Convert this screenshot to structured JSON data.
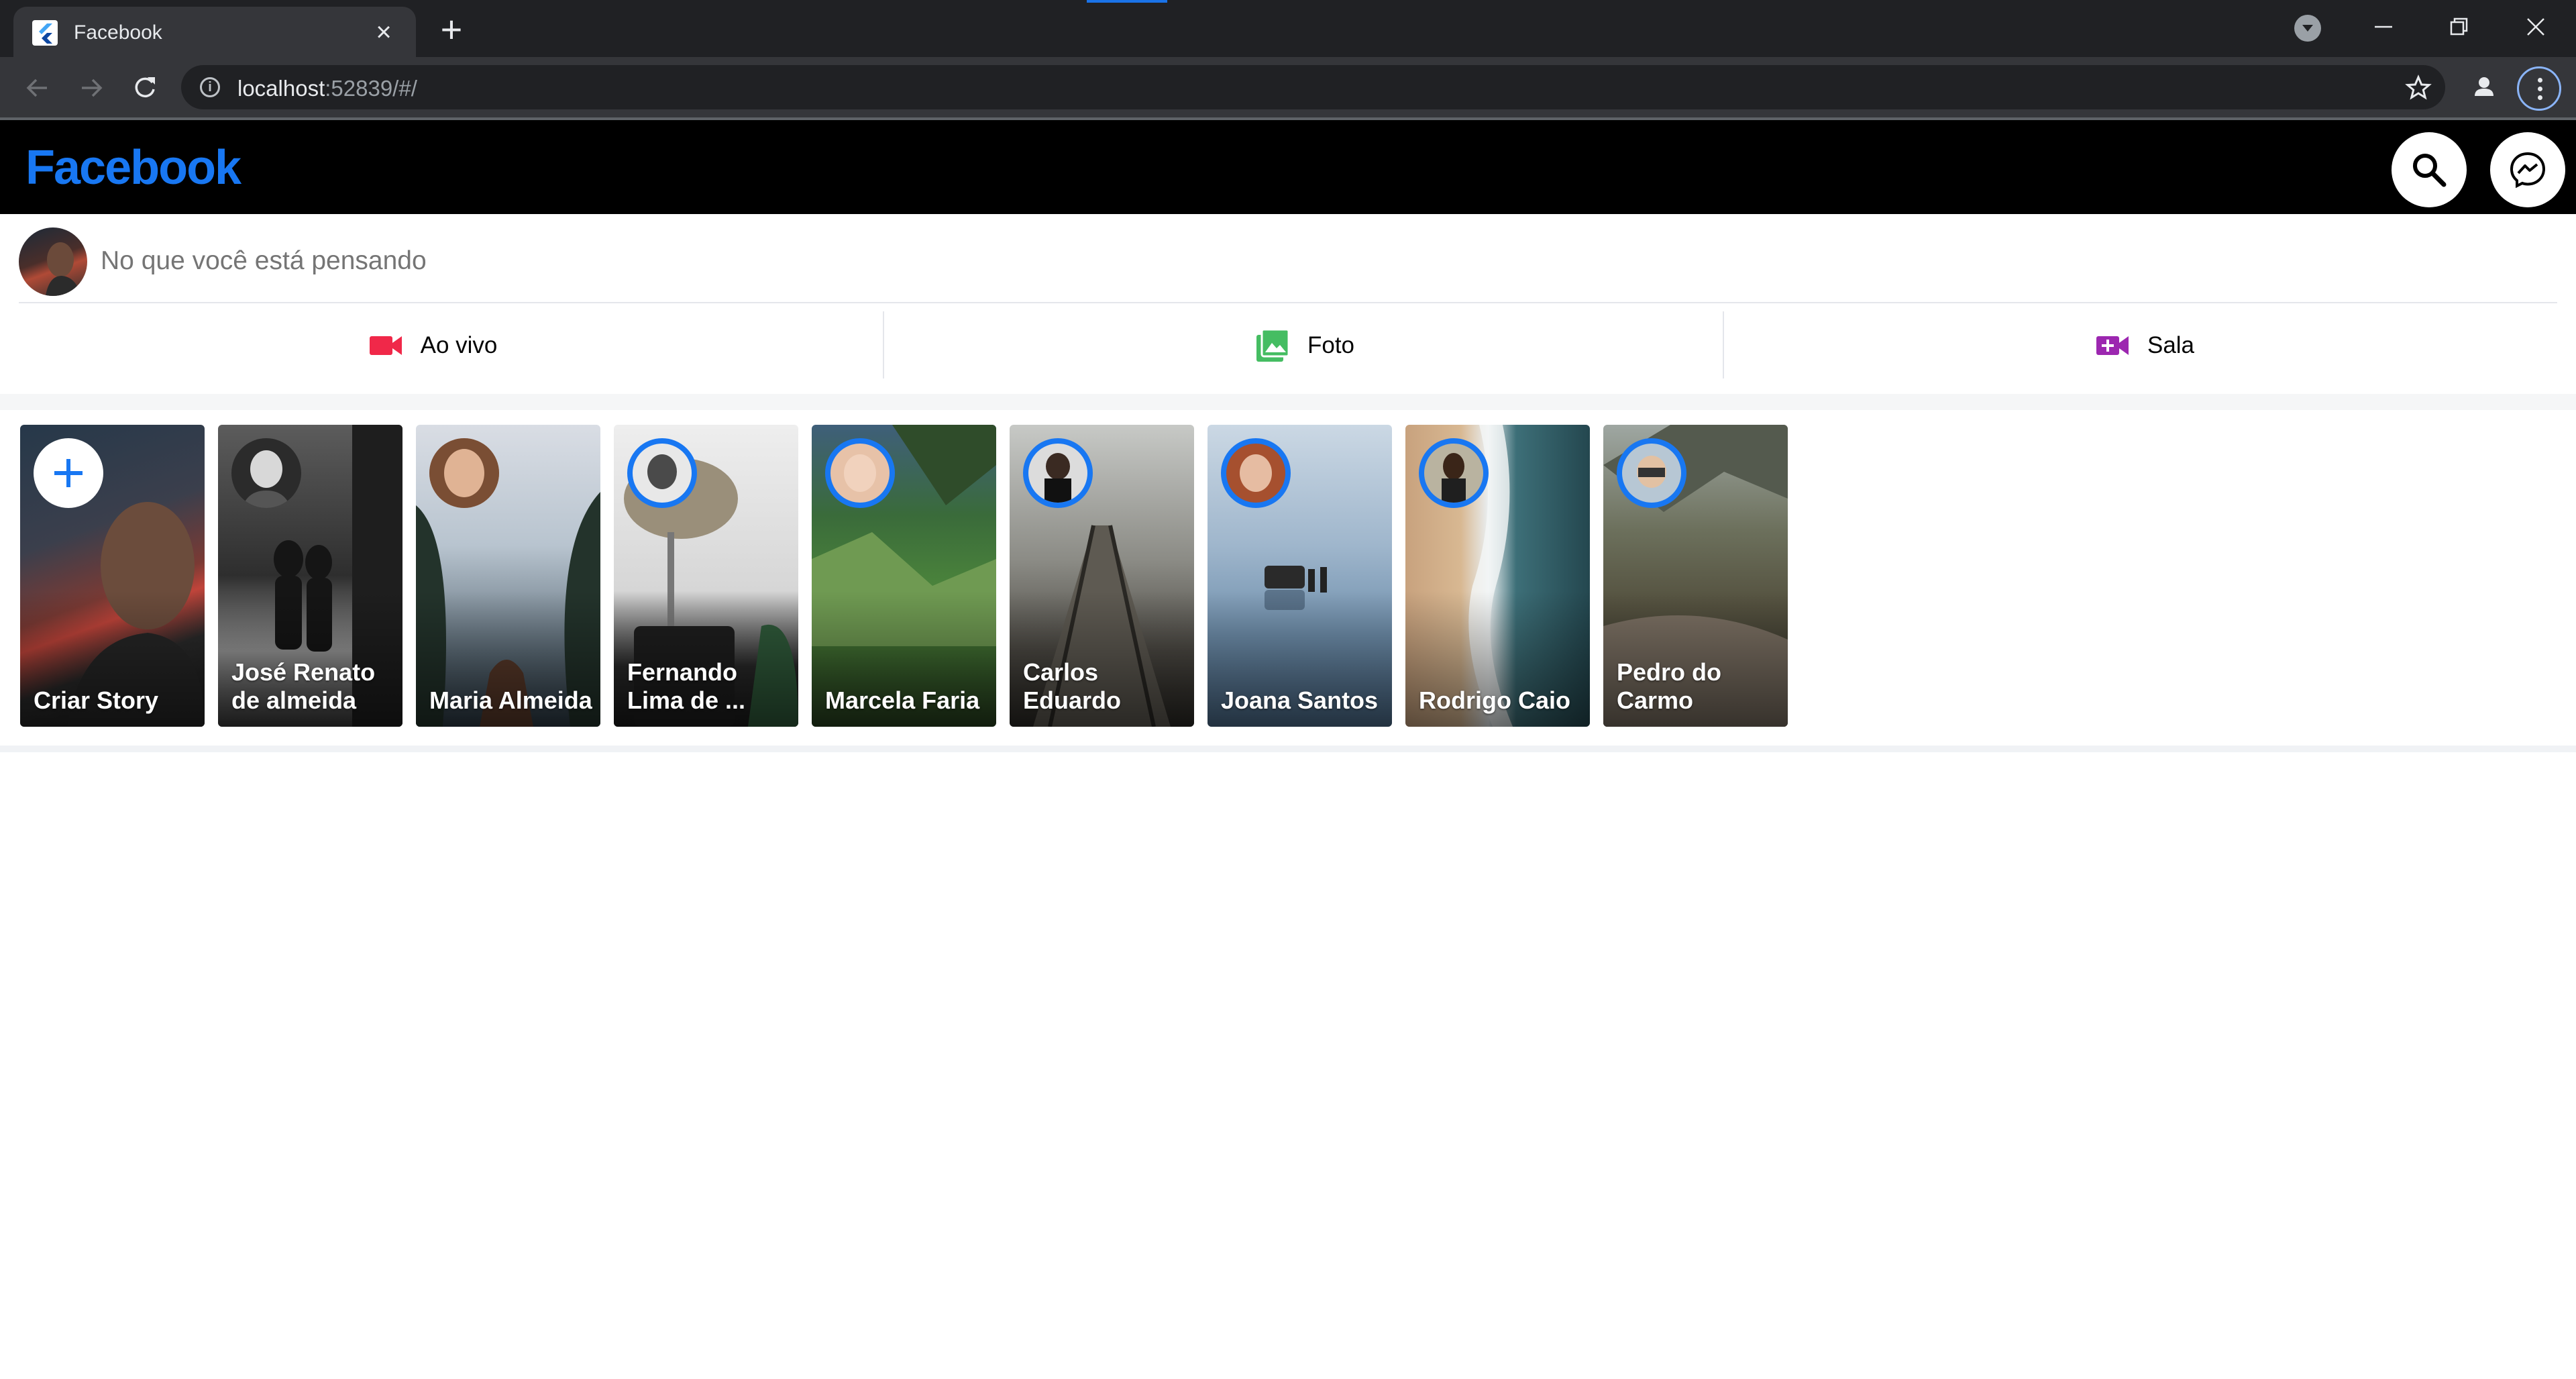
{
  "browser": {
    "tab_title": "Facebook",
    "url_host": "localhost",
    "url_rest": ":52839/#/"
  },
  "app": {
    "logo": "Facebook",
    "brand_color": "#1877f2"
  },
  "composer": {
    "placeholder": "No que você está pensando",
    "actions": [
      {
        "label": "Ao vivo",
        "icon": "videocam-icon",
        "color": "#f02849"
      },
      {
        "label": "Foto",
        "icon": "photo-library-icon",
        "color": "#45bd62"
      },
      {
        "label": "Sala",
        "icon": "video-call-icon",
        "color": "#9c27b0"
      }
    ]
  },
  "stories": {
    "create_label": "Criar Story",
    "items": [
      {
        "name": "José Renato de almeida"
      },
      {
        "name": "Maria Almeida"
      },
      {
        "name": "Fernando Lima de ..."
      },
      {
        "name": "Marcela Faria"
      },
      {
        "name": "Carlos Eduardo"
      },
      {
        "name": "Joana Santos"
      },
      {
        "name": "Rodrigo Caio"
      },
      {
        "name": "Pedro do Carmo"
      }
    ]
  }
}
